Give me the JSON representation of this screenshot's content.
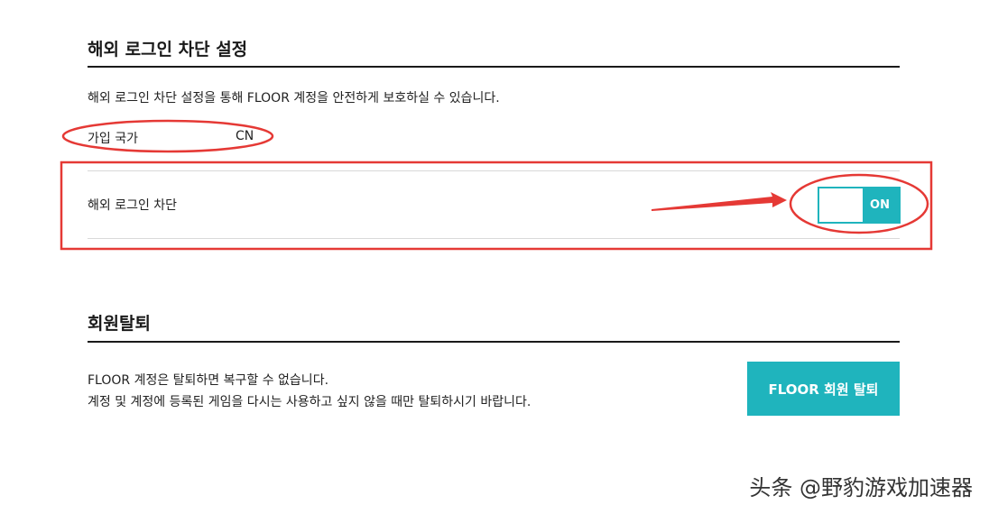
{
  "overseas_login": {
    "title": "해외 로그인 차단 설정",
    "description": "해외 로그인 차단 설정을 통해 FLOOR 계정을 안전하게 보호하실 수 있습니다.",
    "country_label": "가입 국가",
    "country_value": "CN",
    "block_label": "해외 로그인 차단",
    "toggle_state": "ON"
  },
  "withdrawal": {
    "title": "회원탈퇴",
    "line1": "FLOOR 계정은 탈퇴하면 복구할 수 없습니다.",
    "line2": "계정 및 계정에 등록된 게임을 다시는 사용하고 싶지 않을 때만 탈퇴하시기 바랍니다.",
    "button_label": "FLOOR 회원 탈퇴"
  },
  "watermark": "头条 @野豹游戏加速器",
  "colors": {
    "accent": "#1fb4bd",
    "annotation": "#e53935"
  }
}
